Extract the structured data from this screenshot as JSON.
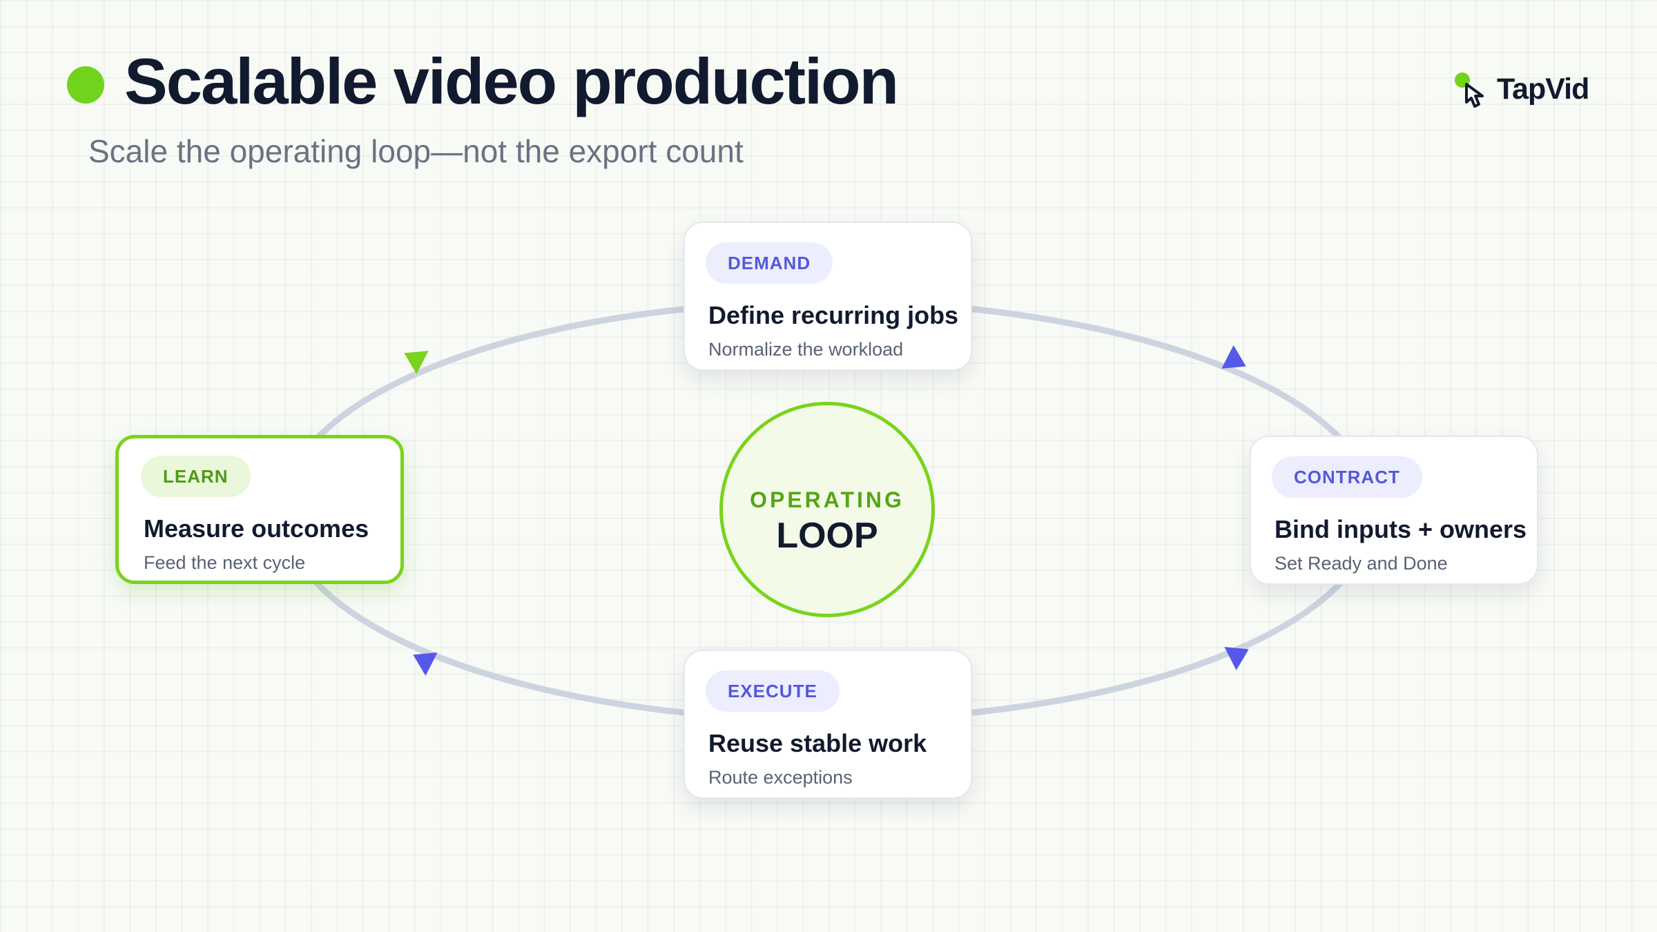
{
  "header": {
    "title": "Scalable video production",
    "subtitle": "Scale the operating loop—not the export count"
  },
  "brand": {
    "name": "TapVid",
    "icon": "pointer-hand-icon"
  },
  "hub": {
    "top_label": "OPERATING",
    "main_label": "LOOP"
  },
  "stages": [
    {
      "id": "demand",
      "tag": "DEMAND",
      "title": "Define recurring jobs",
      "subtitle": "Normalize the workload",
      "highlighted": false
    },
    {
      "id": "contract",
      "tag": "CONTRACT",
      "title": "Bind inputs + owners",
      "subtitle": "Set Ready and Done",
      "highlighted": false
    },
    {
      "id": "execute",
      "tag": "EXECUTE",
      "title": "Reuse stable work",
      "subtitle": "Route exceptions",
      "highlighted": false
    },
    {
      "id": "learn",
      "tag": "LEARN",
      "title": "Measure outcomes",
      "subtitle": "Feed the next cycle",
      "highlighted": true
    }
  ],
  "colors": {
    "accent_green": "#7ad31c",
    "accent_indigo": "#5558e8",
    "ring": "#cdd4e0",
    "text_dark": "#111a2e"
  }
}
